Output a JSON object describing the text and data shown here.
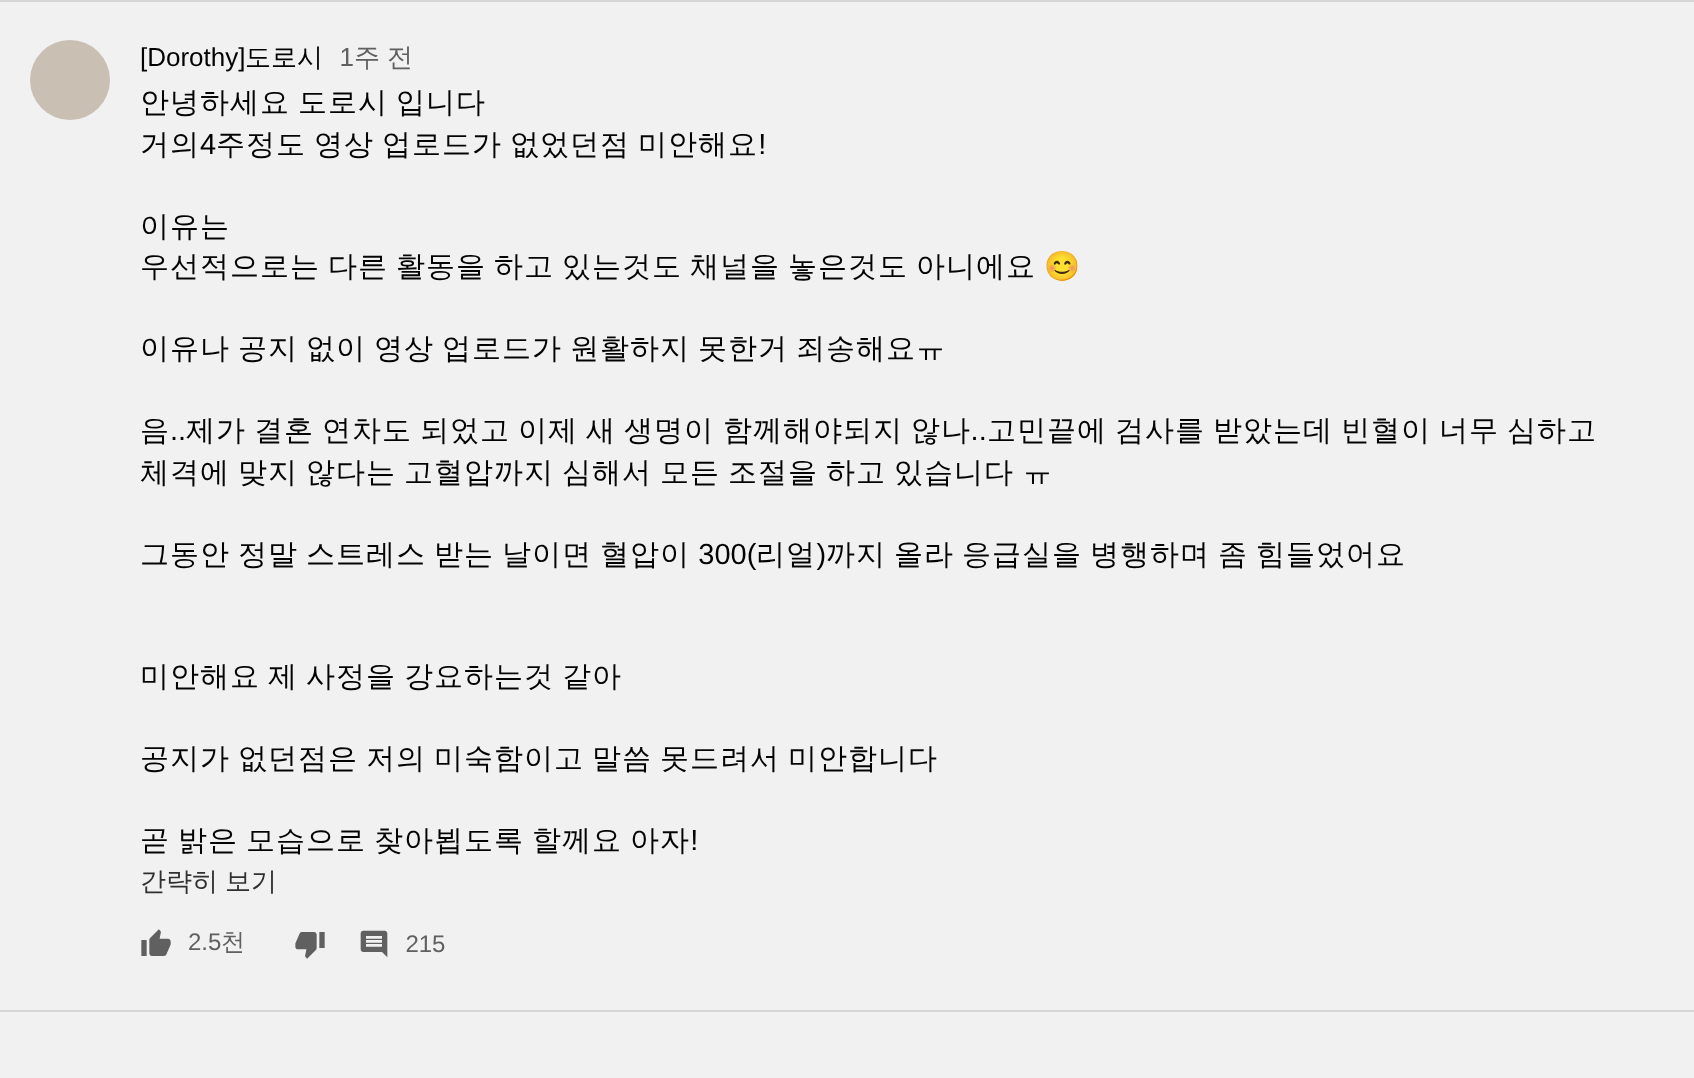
{
  "comment": {
    "author": "[Dorothy]도로시",
    "time": "1주 전",
    "text": "안녕하세요 도로시 입니다\n거의4주정도 영상 업로드가 없었던점 미안해요!\n\n이유는\n우선적으로는 다른 활동을 하고 있는것도 채널을 놓은것도 아니에요 😊\n\n이유나 공지 없이 영상 업로드가 원활하지 못한거 죄송해요ㅠ\n\n음..제가 결혼 연차도 되었고 이제 새 생명이 함께해야되지 않나..고민끝에 검사를 받았는데 빈혈이 너무 심하고 체격에 맞지 않다는 고혈압까지 심해서 모든 조절을 하고 있습니다 ㅠ\n\n그동안 정말 스트레스 받는 날이면 혈압이 300(리얼)까지 올라 응급실을 병행하며 좀 힘들었어요\n\n\n미안해요 제 사정을 강요하는것 같아\n\n공지가 없던점은 저의 미숙함이고 말씀 못드려서 미안합니다\n\n곧 밝은 모습으로 찾아뵙도록 할께요 아자!",
    "collapse": "간략히 보기",
    "likes": "2.5천",
    "replies": "215"
  }
}
